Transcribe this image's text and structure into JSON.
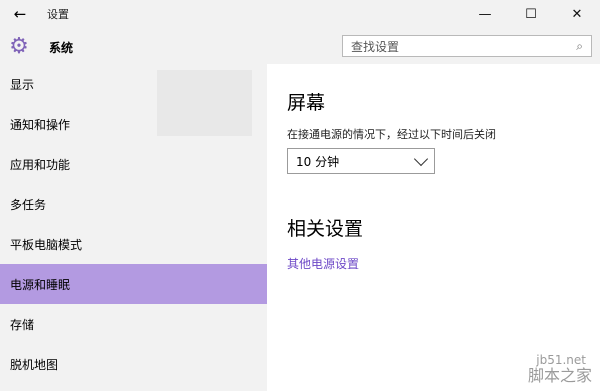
{
  "titlebar": {
    "title": "设置",
    "back_icon": "←",
    "minimize_icon": "—",
    "maximize_icon": "☐",
    "close_icon": "✕"
  },
  "appbar": {
    "title": "系统",
    "gear_icon": "⚙",
    "search_placeholder": "查找设置",
    "search_icon": "⌕"
  },
  "sidebar": {
    "items": [
      {
        "label": "显示"
      },
      {
        "label": "通知和操作"
      },
      {
        "label": "应用和功能"
      },
      {
        "label": "多任务"
      },
      {
        "label": "平板电脑模式"
      },
      {
        "label": "电源和睡眠"
      },
      {
        "label": "存储"
      },
      {
        "label": "脱机地图"
      }
    ],
    "active_color": "#b39ae1"
  },
  "main": {
    "section_screen_title": "屏幕",
    "screen_desc": "在接通电源的情况下，经过以下时间后关闭",
    "dropdown_value": "10 分钟",
    "section_related_title": "相关设置",
    "related_link": "其他电源设置",
    "link_color": "#6d48c7"
  },
  "watermark": {
    "site": "jb51.net",
    "brand": "脚本之家"
  }
}
